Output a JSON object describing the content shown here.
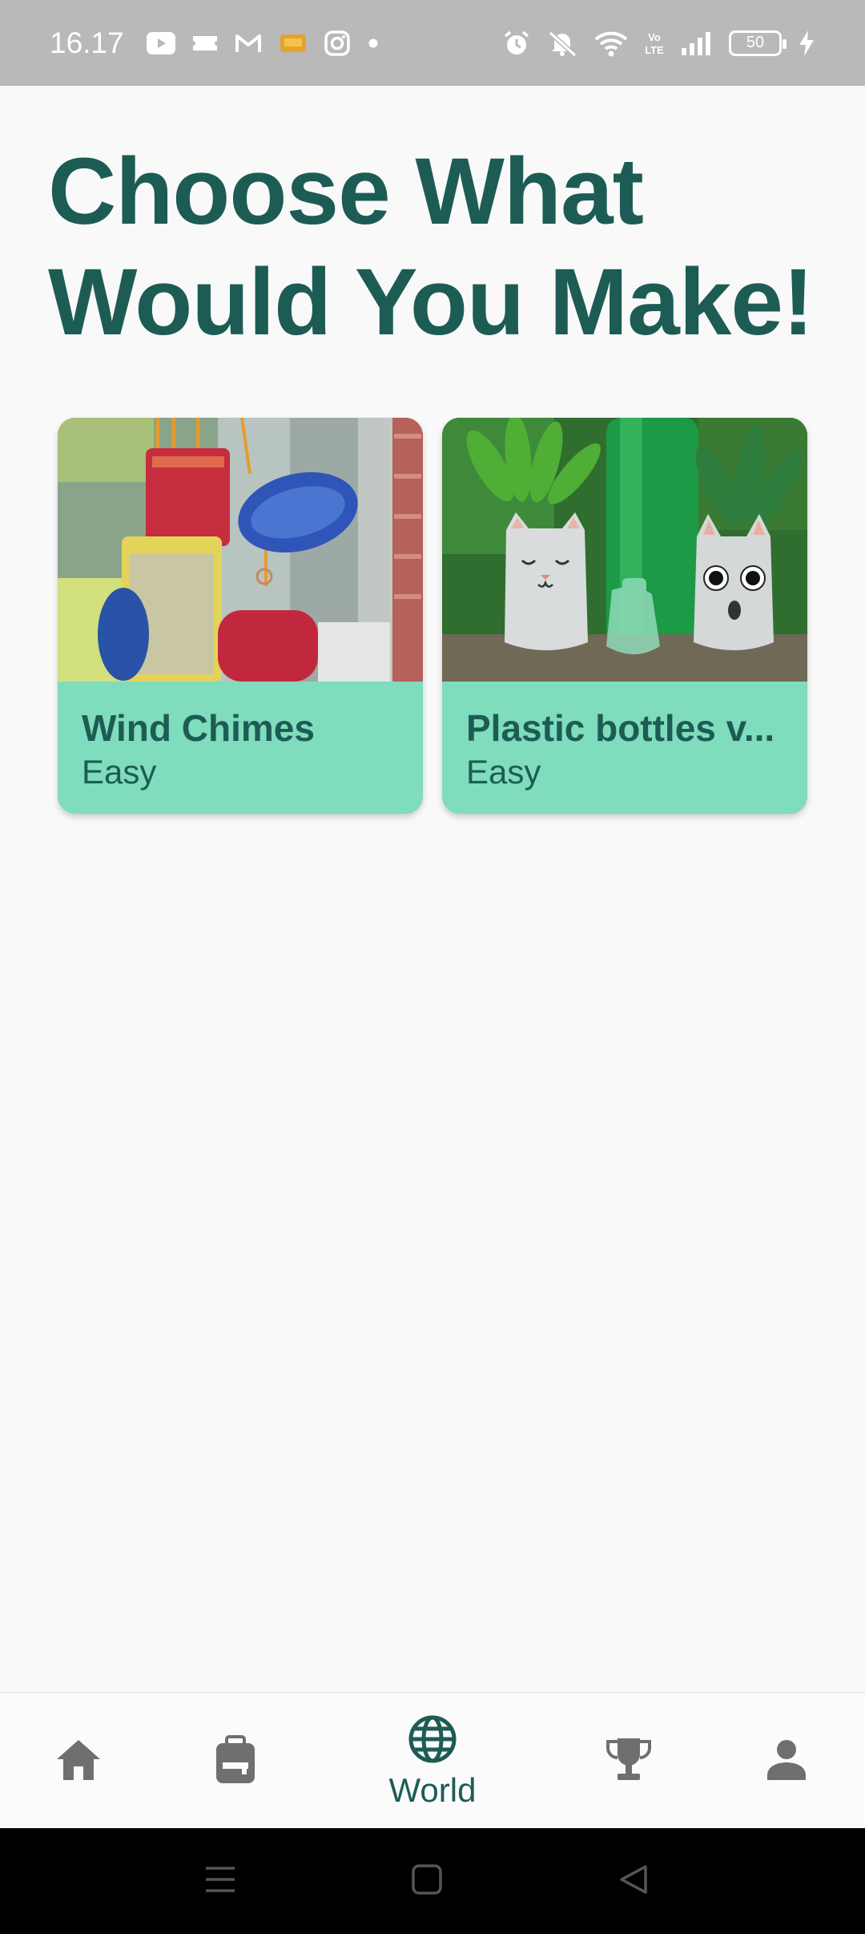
{
  "status_bar": {
    "time": "16.17",
    "battery": "50",
    "left_icons": [
      "youtube-icon",
      "ticket-icon",
      "gmail-icon",
      "app-notification-icon",
      "instagram-icon",
      "dot-icon"
    ],
    "right_icons": [
      "alarm-icon",
      "mute-icon",
      "wifi-icon",
      "volte-icon",
      "signal-icon",
      "battery-icon",
      "charging-icon"
    ]
  },
  "page": {
    "title": "Choose What Would You Make!"
  },
  "cards": [
    {
      "title": "Wind Chimes",
      "difficulty": "Easy",
      "image": "wind-chimes-photo"
    },
    {
      "title": "Plastic bottles v...",
      "difficulty": "Easy",
      "image": "plastic-bottle-planters-photo"
    }
  ],
  "bottom_nav": {
    "items": [
      {
        "icon": "home-icon",
        "label": ""
      },
      {
        "icon": "backpack-icon",
        "label": ""
      },
      {
        "icon": "globe-icon",
        "label": "World",
        "active": true
      },
      {
        "icon": "trophy-icon",
        "label": ""
      },
      {
        "icon": "person-icon",
        "label": ""
      }
    ]
  },
  "colors": {
    "primary": "#1d5c55",
    "card_bg": "#7fdcbc",
    "status_bar": "#b9b9b9",
    "background": "#f9f9f9"
  }
}
